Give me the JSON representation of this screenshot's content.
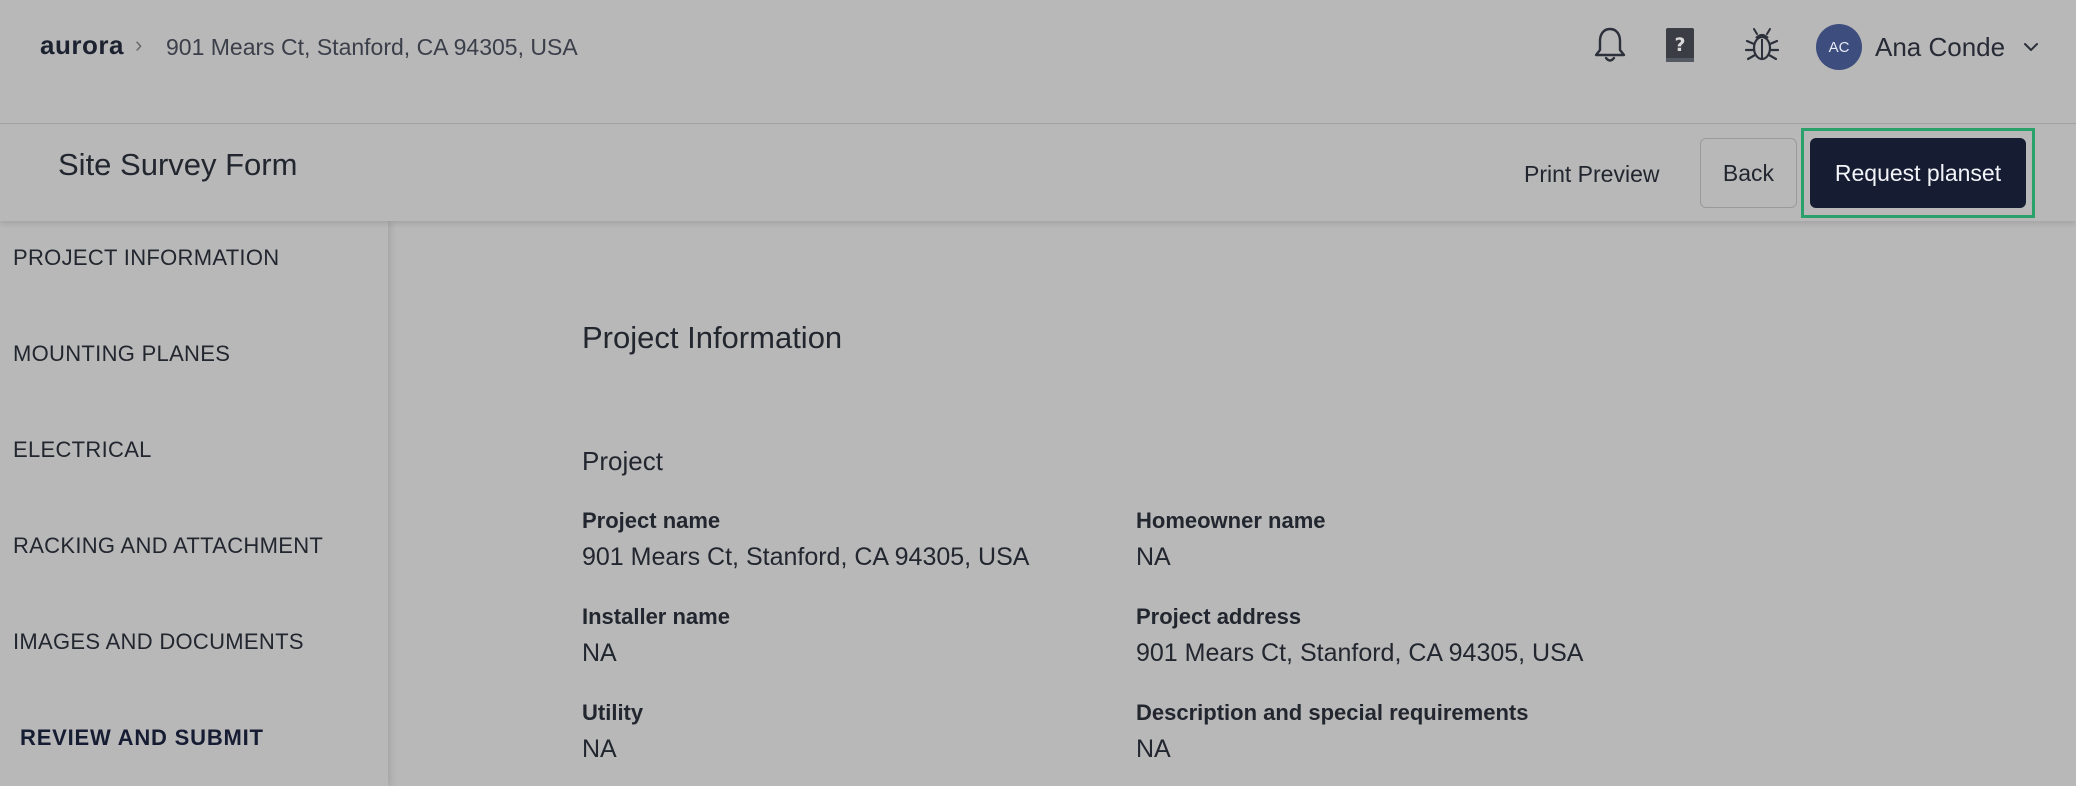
{
  "header": {
    "logo": "aurora",
    "breadcrumb_separator": "›",
    "address": "901 Mears Ct, Stanford, CA 94305, USA",
    "icons": [
      "bell-icon",
      "help-book-icon",
      "bug-icon"
    ],
    "user": {
      "initials": "AC",
      "name": "Ana Conde"
    }
  },
  "subheader": {
    "title": "Site Survey Form",
    "print_preview": "Print Preview",
    "back": "Back",
    "request_planset": "Request planset"
  },
  "sidebar": {
    "items": [
      {
        "label": "PROJECT INFORMATION"
      },
      {
        "label": "MOUNTING PLANES"
      },
      {
        "label": "ELECTRICAL"
      },
      {
        "label": "RACKING AND ATTACHMENT"
      },
      {
        "label": "IMAGES AND DOCUMENTS"
      },
      {
        "label": "REVIEW AND SUBMIT"
      }
    ],
    "active": "REVIEW AND SUBMIT"
  },
  "main": {
    "section_title": "Project Information",
    "group_title": "Project",
    "fields": [
      {
        "label": "Project name",
        "value": "901 Mears Ct, Stanford, CA 94305, USA"
      },
      {
        "label": "Homeowner name",
        "value": "NA"
      },
      {
        "label": "Installer name",
        "value": "NA"
      },
      {
        "label": "Project address",
        "value": "901 Mears Ct, Stanford, CA 94305, USA"
      },
      {
        "label": "Utility",
        "value": "NA"
      },
      {
        "label": "Description and special requirements",
        "value": "NA"
      }
    ]
  },
  "colors": {
    "background": "#b8b8b8",
    "primary_button": "#161d33",
    "highlight_border": "#2aa06a",
    "avatar": "#3d4d7d"
  }
}
